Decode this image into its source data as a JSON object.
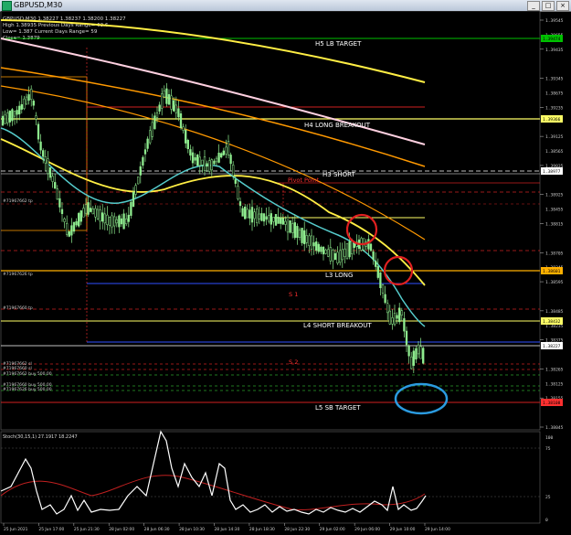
{
  "window": {
    "title": "GBPUSD,M30"
  },
  "info": {
    "line1": "GBPUSD,M30  1.38227 1.38237 1.38200 1.38227",
    "line2": "High 1.38935    Previous Days Range= 63.6",
    "line3": "Low= 1.387    Current Days Range= 59",
    "line4": "Close= 1.3879"
  },
  "labels": {
    "h5": "H5 LB TARGET",
    "h4": "H4 LONG BREAKOUT",
    "h3": "H3 SHORT",
    "pivot": "Pivot Point",
    "l3": "L3 LONG",
    "s1": "S 1",
    "l4": "L4 SHORT BREAKOUT",
    "s2": "S 2",
    "l5": "L5 SB TARGET"
  },
  "orders": {
    "tp1": "#71967662 tp",
    "tp2": "#71967626 tp",
    "tp3": "#71967660 tp",
    "sl1": "#71967662 sl",
    "sl2": "#71967660 sl",
    "buy1": "#71967662 buy 500.00",
    "buy2": "#71967660 buy 500.00",
    "buy3": "#71967626 buy 500.00"
  },
  "price_axis": {
    "ticks": [
      "1.39545",
      "1.39435",
      "1.39345",
      "1.39235",
      "1.39125",
      "1.39035",
      "1.38925",
      "1.38815",
      "1.38705",
      "1.38595",
      "1.38485",
      "1.38375",
      "1.38265",
      "1.38155",
      "1.38045"
    ],
    "extra_ticks": [
      "1.39655",
      "1.38675",
      "1.38565",
      "1.38455",
      "1.38345",
      "1.38235",
      "1.38125",
      "1.38015"
    ],
    "markers": [
      {
        "text": "1.39474",
        "color": "#00c000"
      },
      {
        "text": "1.39366",
        "color": "#ffff66"
      },
      {
        "text": "1.38977",
        "color": "#ffffff"
      },
      {
        "text": "1.38601",
        "color": "#ffb000"
      },
      {
        "text": "1.38432",
        "color": "#ffff66"
      },
      {
        "text": "1.38227",
        "color": "#ffffff"
      },
      {
        "text": "1.38108",
        "color": "#ff3030"
      }
    ]
  },
  "stoch": {
    "title": "Stoch(30,15,1) 27.1917 18.2247",
    "ticks": [
      "100",
      "75",
      "25",
      "0"
    ]
  },
  "time_axis": {
    "labels": [
      "25 Jun 2021",
      "25 Jun 17:00",
      "25 Jun 21:30",
      "28 Jun 02:00",
      "28 Jun 06:30",
      "28 Jun 10:30",
      "28 Jun 14:30",
      "28 Jun 18:30",
      "28 Jun 22:30",
      "29 Jun 02:00",
      "29 Jun 06:00",
      "29 Jun 10:00",
      "29 Jun 14:00"
    ]
  },
  "colors": {
    "candle": "#90ee90",
    "ma_white": "#ffd0e0",
    "ma_yellow": "#ffee44",
    "ma_orange": "#ff9900",
    "ma_cyan": "#55cccc",
    "circle_red": "#e02020",
    "circle_blue": "#2b9be0"
  }
}
